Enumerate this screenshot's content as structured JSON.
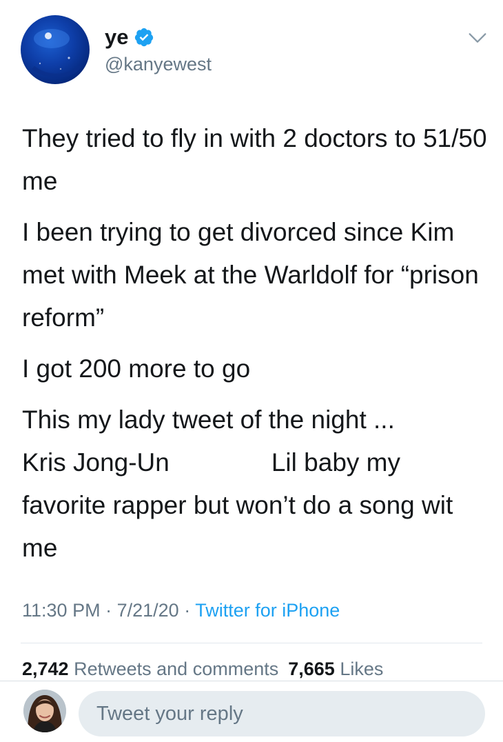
{
  "author": {
    "display_name": "ye",
    "handle": "@kanyewest",
    "verified": true,
    "avatar_icon": "blue-orb-avatar",
    "verified_icon": "verified-badge-icon",
    "menu_icon": "chevron-down-icon"
  },
  "tweet": {
    "paragraphs": [
      "They tried to fly in with 2 doctors to 51/50 me",
      "I been trying to get divorced since Kim met with Meek at the Warldolf for “prison reform”",
      "I got 200 more to go"
    ],
    "last_paragraph": {
      "line1": "This my lady tweet of the night ...",
      "part_a": "Kris Jong-Un",
      "part_b": "Lil baby my favorite rapper but won’t do a song wit me"
    },
    "time": "11:30 PM",
    "date": "7/21/20",
    "separator": "·",
    "source": "Twitter for iPhone"
  },
  "stats": {
    "retweets_count": "2,742",
    "retweets_label": "Retweets and comments",
    "likes_count": "7,665",
    "likes_label": "Likes"
  },
  "reply": {
    "placeholder": "Tweet your reply",
    "avatar_icon": "user-avatar"
  },
  "colors": {
    "text": "#14171a",
    "secondary": "#657786",
    "link": "#1da1f2",
    "verified": "#1da1f2",
    "reply_bg": "#e6ecf0"
  }
}
